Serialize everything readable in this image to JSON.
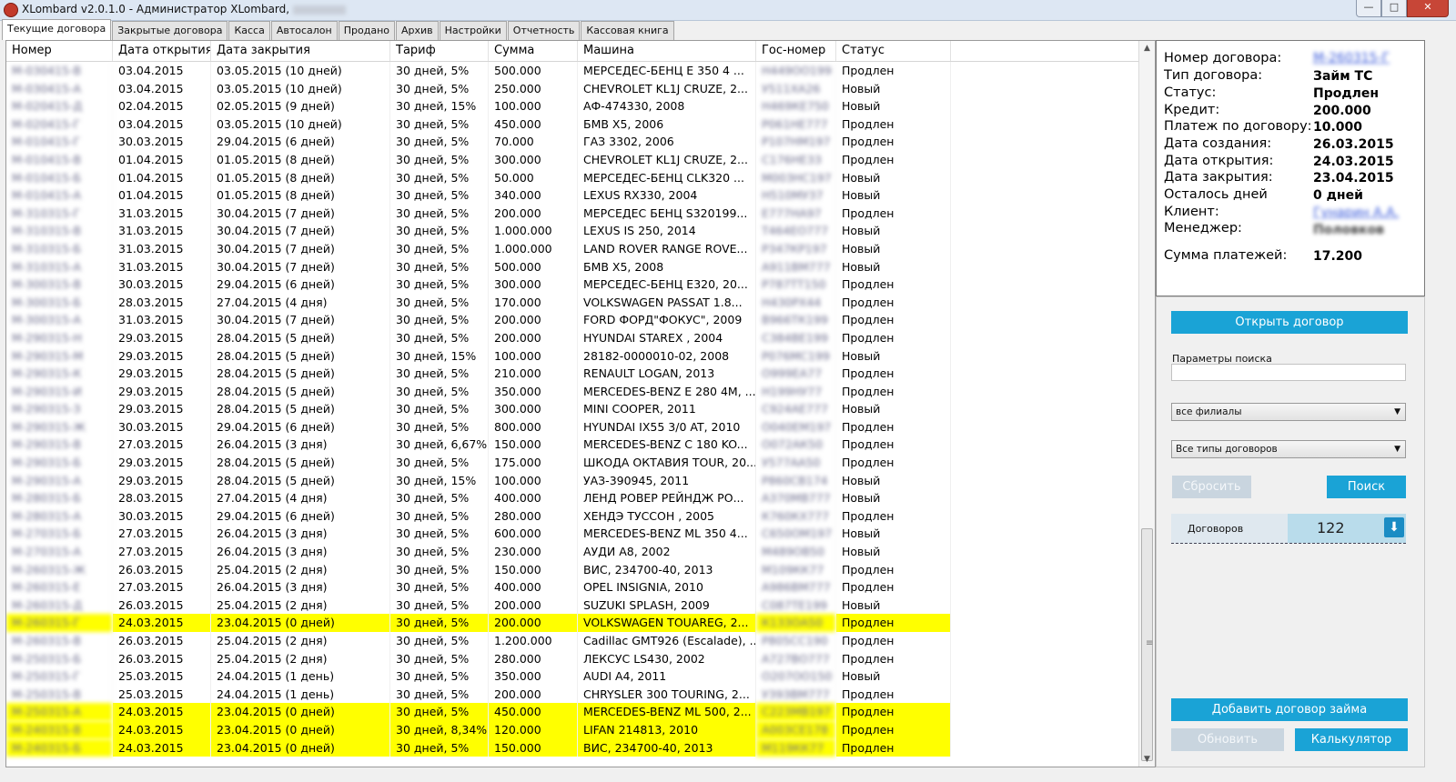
{
  "window": {
    "title": "XLombard v2.0.1.0 - Администратор XLombard,",
    "controls": {
      "minimize": "—",
      "maximize": "□",
      "close": "✕"
    }
  },
  "tabs": [
    "Текущие договора",
    "Закрытые договора",
    "Касса",
    "Автосалон",
    "Продано",
    "Архив",
    "Настройки",
    "Отчетность",
    "Кассовая книга"
  ],
  "grid": {
    "columns": [
      "Номер",
      "Дата открытия",
      "Дата закрытия",
      "Тариф",
      "Сумма",
      "Машина",
      "Гос-номер",
      "Статус"
    ],
    "rows": [
      {
        "num": "М-030415-В",
        "open": "03.04.2015",
        "close": "03.05.2015 (10 дней)",
        "tariff": "30 дней, 5%",
        "sum": "500.000",
        "car": "МЕРСЕДЕС-БЕНЦ Е 350 4 ...",
        "plate": "Н449ОО199",
        "status": "Продлен",
        "hl": false
      },
      {
        "num": "М-030415-А",
        "open": "03.04.2015",
        "close": "03.05.2015 (10 дней)",
        "tariff": "30 дней, 5%",
        "sum": "250.000",
        "car": "CHEVROLET KL1J CRUZE, 2...",
        "plate": "У511ХА26",
        "status": "Новый",
        "hl": false
      },
      {
        "num": "М-020415-Д",
        "open": "02.04.2015",
        "close": "02.05.2015 (9 дней)",
        "tariff": "30 дней, 15%",
        "sum": "100.000",
        "car": "АФ-474330, 2008",
        "plate": "Н469КЕ750",
        "status": "Новый",
        "hl": false
      },
      {
        "num": "М-020415-Г",
        "open": "03.04.2015",
        "close": "03.05.2015 (10 дней)",
        "tariff": "30 дней, 5%",
        "sum": "450.000",
        "car": "БМВ Х5, 2006",
        "plate": "Р061НЕ777",
        "status": "Продлен",
        "hl": false
      },
      {
        "num": "М-010415-Г",
        "open": "30.03.2015",
        "close": "29.04.2015 (6 дней)",
        "tariff": "30 дней, 5%",
        "sum": "70.000",
        "car": "ГАЗ 3302, 2006",
        "plate": "Р107НМ197",
        "status": "Продлен",
        "hl": false
      },
      {
        "num": "М-010415-В",
        "open": "01.04.2015",
        "close": "01.05.2015 (8 дней)",
        "tariff": "30 дней, 5%",
        "sum": "300.000",
        "car": "CHEVROLET KL1J CRUZE, 2...",
        "plate": "С176НЕ33",
        "status": "Продлен",
        "hl": false
      },
      {
        "num": "М-010415-Б",
        "open": "01.04.2015",
        "close": "01.05.2015 (8 дней)",
        "tariff": "30 дней, 5%",
        "sum": "50.000",
        "car": "МЕРСЕДЕС-БЕНЦ CLK320 ...",
        "plate": "М003НС197",
        "status": "Новый",
        "hl": false
      },
      {
        "num": "М-010415-А",
        "open": "01.04.2015",
        "close": "01.05.2015 (8 дней)",
        "tariff": "30 дней, 5%",
        "sum": "340.000",
        "car": "LEXUS RX330, 2004",
        "plate": "Н510МУ37",
        "status": "Новый",
        "hl": false
      },
      {
        "num": "М-310315-Г",
        "open": "31.03.2015",
        "close": "30.04.2015 (7 дней)",
        "tariff": "30 дней, 5%",
        "sum": "200.000",
        "car": "МЕРСЕДЕС БЕНЦ S320199...",
        "plate": "Е777НА97",
        "status": "Продлен",
        "hl": false
      },
      {
        "num": "М-310315-В",
        "open": "31.03.2015",
        "close": "30.04.2015 (7 дней)",
        "tariff": "30 дней, 5%",
        "sum": "1.000.000",
        "car": "LEXUS IS 250, 2014",
        "plate": "Т464ЕО777",
        "status": "Новый",
        "hl": false
      },
      {
        "num": "М-310315-Б",
        "open": "31.03.2015",
        "close": "30.04.2015 (7 дней)",
        "tariff": "30 дней, 5%",
        "sum": "1.000.000",
        "car": "LAND ROVER RANGE ROVE...",
        "plate": "Р347КР197",
        "status": "Новый",
        "hl": false
      },
      {
        "num": "М-310315-А",
        "open": "31.03.2015",
        "close": "30.04.2015 (7 дней)",
        "tariff": "30 дней, 5%",
        "sum": "500.000",
        "car": "БМВ Х5, 2008",
        "plate": "А911ВМ777",
        "status": "Новый",
        "hl": false
      },
      {
        "num": "М-300315-В",
        "open": "30.03.2015",
        "close": "29.04.2015 (6 дней)",
        "tariff": "30 дней, 5%",
        "sum": "300.000",
        "car": "МЕРСЕДЕС-БЕНЦ Е320, 20...",
        "plate": "Р787ТТ150",
        "status": "Продлен",
        "hl": false
      },
      {
        "num": "М-300315-Б",
        "open": "28.03.2015",
        "close": "27.04.2015 (4 дня)",
        "tariff": "30 дней, 5%",
        "sum": "170.000",
        "car": "VOLKSWAGEN PASSAT 1.8...",
        "plate": "Н430РХ44",
        "status": "Продлен",
        "hl": false
      },
      {
        "num": "М-300315-А",
        "open": "31.03.2015",
        "close": "30.04.2015 (7 дней)",
        "tariff": "30 дней, 5%",
        "sum": "200.000",
        "car": "FORD ФОРД\"ФОКУС\", 2009",
        "plate": "В966ТК199",
        "status": "Продлен",
        "hl": false
      },
      {
        "num": "М-290315-Н",
        "open": "29.03.2015",
        "close": "28.04.2015 (5 дней)",
        "tariff": "30 дней, 5%",
        "sum": "200.000",
        "car": "HYUNDAI STAREX , 2004",
        "plate": "С384ВЕ199",
        "status": "Продлен",
        "hl": false
      },
      {
        "num": "М-290315-М",
        "open": "29.03.2015",
        "close": "28.04.2015 (5 дней)",
        "tariff": "30 дней, 15%",
        "sum": "100.000",
        "car": "28182-0000010-02, 2008",
        "plate": "Р076МС199",
        "status": "Новый",
        "hl": false
      },
      {
        "num": "М-290315-К",
        "open": "29.03.2015",
        "close": "28.04.2015 (5 дней)",
        "tariff": "30 дней, 5%",
        "sum": "210.000",
        "car": "RENAULT LOGAN, 2013",
        "plate": "О999ЕА77",
        "status": "Продлен",
        "hl": false
      },
      {
        "num": "М-290315-И",
        "open": "29.03.2015",
        "close": "28.04.2015 (5 дней)",
        "tariff": "30 дней, 5%",
        "sum": "350.000",
        "car": "MERCEDES-BENZ E 280 4M, ...",
        "plate": "Н199НУ77",
        "status": "Продлен",
        "hl": false
      },
      {
        "num": "М-290315-З",
        "open": "29.03.2015",
        "close": "28.04.2015 (5 дней)",
        "tariff": "30 дней, 5%",
        "sum": "300.000",
        "car": "MINI COOPER, 2011",
        "plate": "С924АЕ777",
        "status": "Новый",
        "hl": false
      },
      {
        "num": "М-290315-Ж",
        "open": "30.03.2015",
        "close": "29.04.2015 (6 дней)",
        "tariff": "30 дней, 5%",
        "sum": "800.000",
        "car": "HYUNDAI IX55 3/0 AT, 2010",
        "plate": "О040ЕМ197",
        "status": "Продлен",
        "hl": false
      },
      {
        "num": "М-290315-В",
        "open": "27.03.2015",
        "close": "26.04.2015 (3 дня)",
        "tariff": "30 дней, 6,67%",
        "sum": "150.000",
        "car": "MERCEDES-BENZ C 180 KO...",
        "plate": "О072АК50",
        "status": "Продлен",
        "hl": false
      },
      {
        "num": "М-290315-Б",
        "open": "29.03.2015",
        "close": "28.04.2015 (5 дней)",
        "tariff": "30 дней, 5%",
        "sum": "175.000",
        "car": "ШКОДА ОКТАВИЯ TOUR, 20...",
        "plate": "У577АА50",
        "status": "Продлен",
        "hl": false
      },
      {
        "num": "М-290315-А",
        "open": "29.03.2015",
        "close": "28.04.2015 (5 дней)",
        "tariff": "30 дней, 15%",
        "sum": "100.000",
        "car": "УАЗ-390945, 2011",
        "plate": "Р860СВ174",
        "status": "Новый",
        "hl": false
      },
      {
        "num": "М-280315-Б",
        "open": "28.03.2015",
        "close": "27.04.2015 (4 дня)",
        "tariff": "30 дней, 5%",
        "sum": "400.000",
        "car": "ЛЕНД РОВЕР РЕЙНДЖ РО...",
        "plate": "А370МВ777",
        "status": "Новый",
        "hl": false
      },
      {
        "num": "М-280315-А",
        "open": "30.03.2015",
        "close": "29.04.2015 (6 дней)",
        "tariff": "30 дней, 5%",
        "sum": "280.000",
        "car": "ХЕНДЭ ТУССОН , 2005",
        "plate": "К760КХ777",
        "status": "Продлен",
        "hl": false
      },
      {
        "num": "М-270315-Б",
        "open": "27.03.2015",
        "close": "26.04.2015 (3 дня)",
        "tariff": "30 дней, 5%",
        "sum": "600.000",
        "car": "MERCEDES-BENZ ML 350 4...",
        "plate": "С650ОМ197",
        "status": "Новый",
        "hl": false
      },
      {
        "num": "М-270315-А",
        "open": "27.03.2015",
        "close": "26.04.2015 (3 дня)",
        "tariff": "30 дней, 5%",
        "sum": "230.000",
        "car": "АУДИ А8, 2002",
        "plate": "М489ОВ50",
        "status": "Новый",
        "hl": false
      },
      {
        "num": "М-260315-Ж",
        "open": "26.03.2015",
        "close": "25.04.2015 (2 дня)",
        "tariff": "30 дней, 5%",
        "sum": "150.000",
        "car": "ВИС, 234700-40, 2013",
        "plate": "М109КК77",
        "status": "Продлен",
        "hl": false
      },
      {
        "num": "М-260315-Е",
        "open": "27.03.2015",
        "close": "26.04.2015 (3 дня)",
        "tariff": "30 дней, 5%",
        "sum": "400.000",
        "car": "OPEL INSIGNIA, 2010",
        "plate": "А986ВМ777",
        "status": "Продлен",
        "hl": false
      },
      {
        "num": "М-260315-Д",
        "open": "26.03.2015",
        "close": "25.04.2015 (2 дня)",
        "tariff": "30 дней, 5%",
        "sum": "200.000",
        "car": "SUZUKI SPLASH, 2009",
        "plate": "С087ТЕ199",
        "status": "Новый",
        "hl": false
      },
      {
        "num": "М-260315-Г",
        "open": "24.03.2015",
        "close": "23.04.2015 (0 дней)",
        "tariff": "30 дней, 5%",
        "sum": "200.000",
        "car": "VOLKSWAGEN TOUAREG, 2...",
        "plate": "К133ОА50",
        "status": "Продлен",
        "hl": true
      },
      {
        "num": "М-260315-В",
        "open": "26.03.2015",
        "close": "25.04.2015 (2 дня)",
        "tariff": "30 дней, 5%",
        "sum": "1.200.000",
        "car": "Cadillac GMT926 (Escalade), ...",
        "plate": "Р805СС190",
        "status": "Продлен",
        "hl": false
      },
      {
        "num": "М-250315-Б",
        "open": "26.03.2015",
        "close": "25.04.2015 (2 дня)",
        "tariff": "30 дней, 5%",
        "sum": "280.000",
        "car": "ЛЕКСУС LS430, 2002",
        "plate": "А727ВО777",
        "status": "Продлен",
        "hl": false
      },
      {
        "num": "М-250315-Г",
        "open": "25.03.2015",
        "close": "24.04.2015 (1 день)",
        "tariff": "30 дней, 5%",
        "sum": "350.000",
        "car": "AUDI A4, 2011",
        "plate": "О207ОО150",
        "status": "Новый",
        "hl": false
      },
      {
        "num": "М-250315-В",
        "open": "25.03.2015",
        "close": "24.04.2015 (1 день)",
        "tariff": "30 дней, 5%",
        "sum": "200.000",
        "car": "CHRYSLER 300 TOURING, 2...",
        "plate": "У393ВМ777",
        "status": "Продлен",
        "hl": false
      },
      {
        "num": "М-250315-А",
        "open": "24.03.2015",
        "close": "23.04.2015 (0 дней)",
        "tariff": "30 дней, 5%",
        "sum": "450.000",
        "car": "MERCEDES-BENZ ML 500, 2...",
        "plate": "С223МВ197",
        "status": "Продлен",
        "hl": true
      },
      {
        "num": "М-240315-В",
        "open": "24.03.2015",
        "close": "23.04.2015 (0 дней)",
        "tariff": "30 дней, 8,34%",
        "sum": "120.000",
        "car": "LIFAN 214813, 2010",
        "plate": "А003СЕ178",
        "status": "Продлен",
        "hl": true
      },
      {
        "num": "М-240315-Б",
        "open": "24.03.2015",
        "close": "23.04.2015 (0 дней)",
        "tariff": "30 дней, 5%",
        "sum": "150.000",
        "car": "ВИС, 234700-40, 2013",
        "plate": "М119КК77",
        "status": "Продлен",
        "hl": true
      }
    ]
  },
  "details": {
    "labels": [
      "Номер договора:",
      "Тип договора:",
      "Статус:",
      "Кредит:",
      "Платеж по договору:",
      "Дата создания:",
      "Дата открытия:",
      "Дата закрытия:",
      "Осталось дней",
      "Клиент:",
      "Менеджер:",
      "Сумма платежей:"
    ],
    "contract_number": "М-260315-Г",
    "contract_type": "Займ ТС",
    "status": "Продлен",
    "credit": "200.000",
    "payment": "10.000",
    "created": "26.03.2015",
    "opened": "24.03.2015",
    "closed": "23.04.2015",
    "days_left": "0 дней",
    "client": "Гунарин А.А.",
    "manager": "Половков",
    "payments_sum": "17.200"
  },
  "side": {
    "open_contract": "Открыть договор",
    "search_params_label": "Параметры поиска",
    "search_value": "",
    "branch_select": "все филиалы",
    "type_select": "Все типы договоров",
    "reset_button": "Сбросить",
    "search_button": "Поиск",
    "count_label": "Договоров",
    "count_value": "122",
    "add_loan_button": "Добавить договор займа",
    "refresh_button": "Обновить",
    "calculator_button": "Калькулятор"
  },
  "colors": {
    "accent": "#1aa3d6",
    "highlight": "#ffff00",
    "link": "#3b5bdb"
  }
}
